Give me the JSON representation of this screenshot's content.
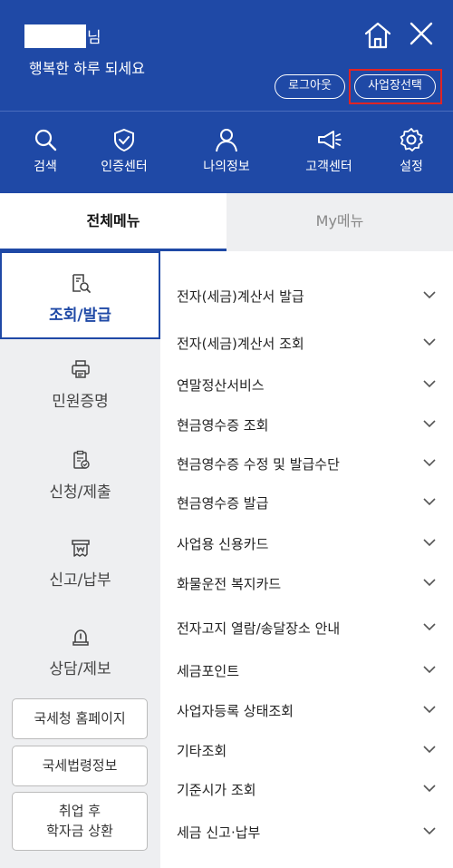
{
  "header": {
    "name_suffix": "님",
    "greeting": "행복한 하루 되세요",
    "logout_label": "로그아웃",
    "business_select_label": "사업장선택"
  },
  "iconbar": [
    {
      "label": "검색",
      "icon": "search-icon"
    },
    {
      "label": "인증센터",
      "icon": "shield-check-icon"
    },
    {
      "label": "나의정보",
      "icon": "person-icon"
    },
    {
      "label": "고객센터",
      "icon": "megaphone-icon"
    },
    {
      "label": "설정",
      "icon": "gear-icon"
    }
  ],
  "tabs": {
    "all": "전체메뉴",
    "my": "My메뉴"
  },
  "categories": [
    {
      "label": "조회/발급",
      "icon": "search-document-icon",
      "active": true
    },
    {
      "label": "민원증명",
      "icon": "printer-icon"
    },
    {
      "label": "신청/제출",
      "icon": "clipboard-check-icon"
    },
    {
      "label": "신고/납부",
      "icon": "won-receipt-icon"
    },
    {
      "label": "상담/제보",
      "icon": "siren-icon"
    }
  ],
  "links": {
    "nts_home": "국세청 홈페이지",
    "nts_law": "국세법령정보",
    "student_loan_line1": "취업 후",
    "student_loan_line2": "학자금 상환"
  },
  "menu": [
    "전자(세금)계산서 발급",
    "전자(세금)계산서 조회",
    "연말정산서비스",
    "현금영수증 조회",
    "현금영수증 수정 및 발급수단",
    "현금영수증 발급",
    "사업용 신용카드",
    "화물운전 복지카드",
    "전자고지 열람/송달장소 안내",
    "세금포인트",
    "사업자등록 상태조회",
    "기타조회",
    "기준시가 조회",
    "세금 신고·납부"
  ],
  "colors": {
    "primary": "#1f49a6",
    "highlight": "#e02424",
    "sidebar_bg": "#eeeff1"
  }
}
